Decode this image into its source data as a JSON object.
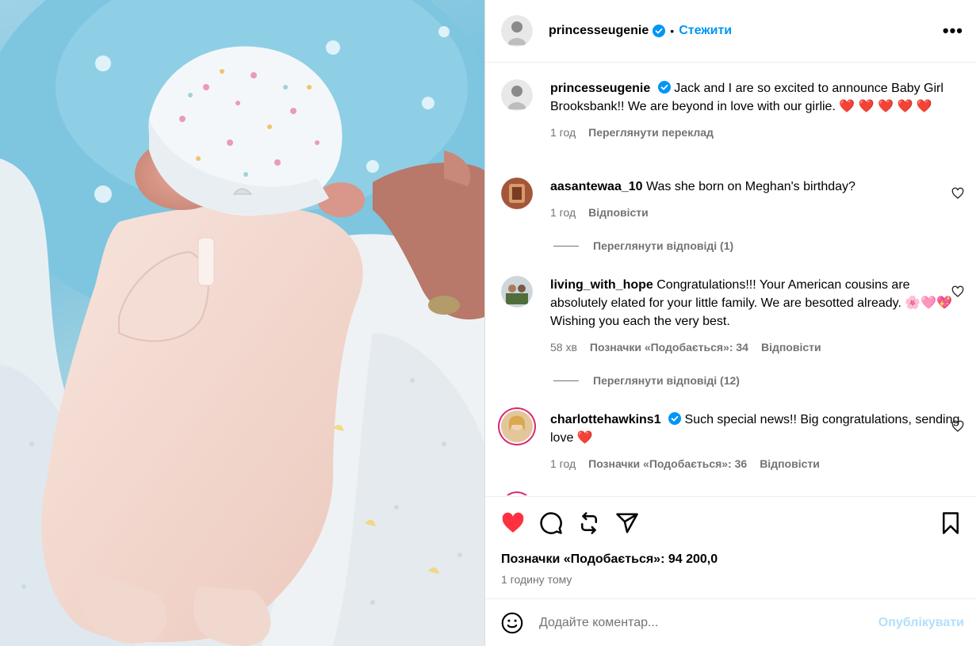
{
  "header": {
    "username": "princesseugenie",
    "follow_label": "Стежити",
    "more_label": "•••"
  },
  "caption": {
    "username": "princesseugenie",
    "text": "Jack and I are so excited to announce Baby Girl Brooksbank!! We are beyond in love with our girlie. ❤️ ❤️ ❤️ ❤️ ❤️",
    "time": "1 год",
    "translate_label": "Переглянути переклад"
  },
  "comments": [
    {
      "username": "aasantewaa_10",
      "text": "Was she born on Meghan's birthday?",
      "time": "1 год",
      "reply_label": "Відповісти",
      "view_replies": "Переглянути відповіді (1)"
    },
    {
      "username": "living_with_hope",
      "text": "Congratulations!!! Your American cousins are absolutely elated for your little family. We are besotted already. 🌸🩷💖 Wishing you each the very best.",
      "time": "58 хв",
      "likes": "Позначки «Подобається»: 34",
      "reply_label": "Відповісти",
      "view_replies": "Переглянути відповіді (12)"
    },
    {
      "username": "charlottehawkins1",
      "text": "Such special news!! Big congratulations, sending love ❤️",
      "time": "1 год",
      "likes": "Позначки «Подобається»: 36",
      "reply_label": "Відповісти"
    }
  ],
  "footer": {
    "likes": "Позначки «Подобається»: 94 200,0",
    "time": "1 годину тому",
    "comment_placeholder": "Додайте коментар...",
    "post_label": "Опублікувати"
  },
  "colors": {
    "accent": "#0095f6",
    "like_red": "#ff3040",
    "muted": "#737373",
    "post_disabled": "#b2dffc"
  },
  "icons": [
    "verified-badge-icon",
    "heart-icon",
    "comment-icon",
    "repost-icon",
    "share-icon",
    "bookmark-icon",
    "emoji-icon",
    "more-icon"
  ]
}
